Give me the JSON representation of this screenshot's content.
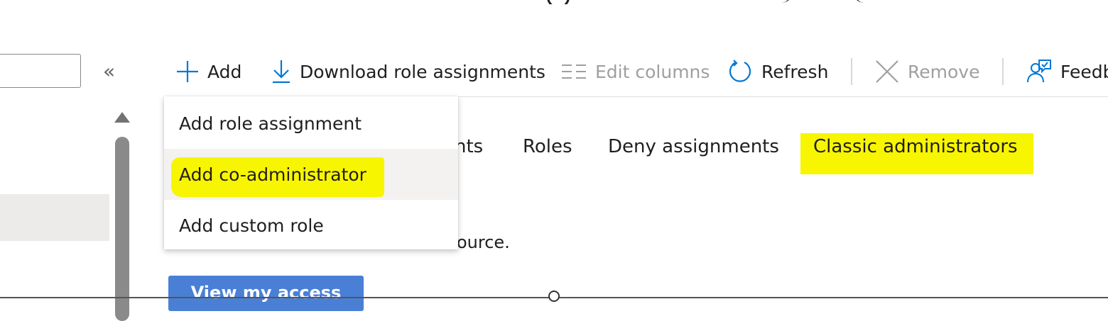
{
  "toolbar": {
    "add": "Add",
    "download": "Download role assignments",
    "edit_columns": "Edit columns",
    "refresh": "Refresh",
    "remove": "Remove",
    "feedback": "Feedback"
  },
  "collapse_glyph": "«",
  "tabs": {
    "role_assignments_partial": "nts",
    "roles": "Roles",
    "deny": "Deny assignments",
    "classic": "Classic administrators"
  },
  "description_partial": "ource.",
  "view_access_button": "View my access",
  "add_menu": {
    "items": [
      "Add role assignment",
      "Add co-administrator",
      "Add custom role"
    ]
  },
  "colors": {
    "accent": "#0078d4",
    "highlight": "#f8f500",
    "primary_button": "#4a7fd6",
    "menu_hover": "#f3f2f1"
  }
}
